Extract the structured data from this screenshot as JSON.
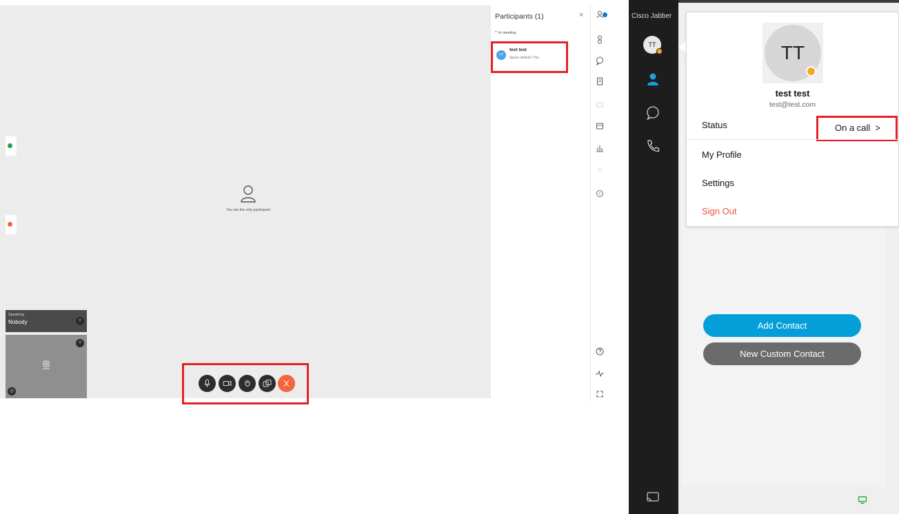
{
  "webex": {
    "stage": {
      "only_participant_message": "You are the only participant"
    },
    "speaking": {
      "label": "Speaking",
      "value": "Nobody"
    },
    "controls": [
      "mute",
      "video",
      "raise-hand",
      "share",
      "leave"
    ],
    "participants_panel": {
      "title": "Participants (1)",
      "close_glyph": "×",
      "section_chevron": "^",
      "section_label": "In meeting",
      "participant": {
        "initials": "TT",
        "name": "test test",
        "sub": "Space default | You"
      }
    }
  },
  "jabber": {
    "title": "Cisco Jabber",
    "user_initials": "TT",
    "popup": {
      "initials": "TT",
      "name": "test test",
      "email": "test@test.com",
      "status_label": "Status",
      "status_value": "On a call  >",
      "my_profile": "My Profile",
      "settings": "Settings",
      "sign_out": "Sign Out"
    },
    "buttons": {
      "add_contact": "Add Contact",
      "new_custom_contact": "New Custom Contact"
    }
  },
  "colors": {
    "highlight": "#e32028",
    "jabber_blue": "#049fd9",
    "presence_away": "#f5a623",
    "leave_red": "#f4643e",
    "sign_out": "#e8553a"
  }
}
